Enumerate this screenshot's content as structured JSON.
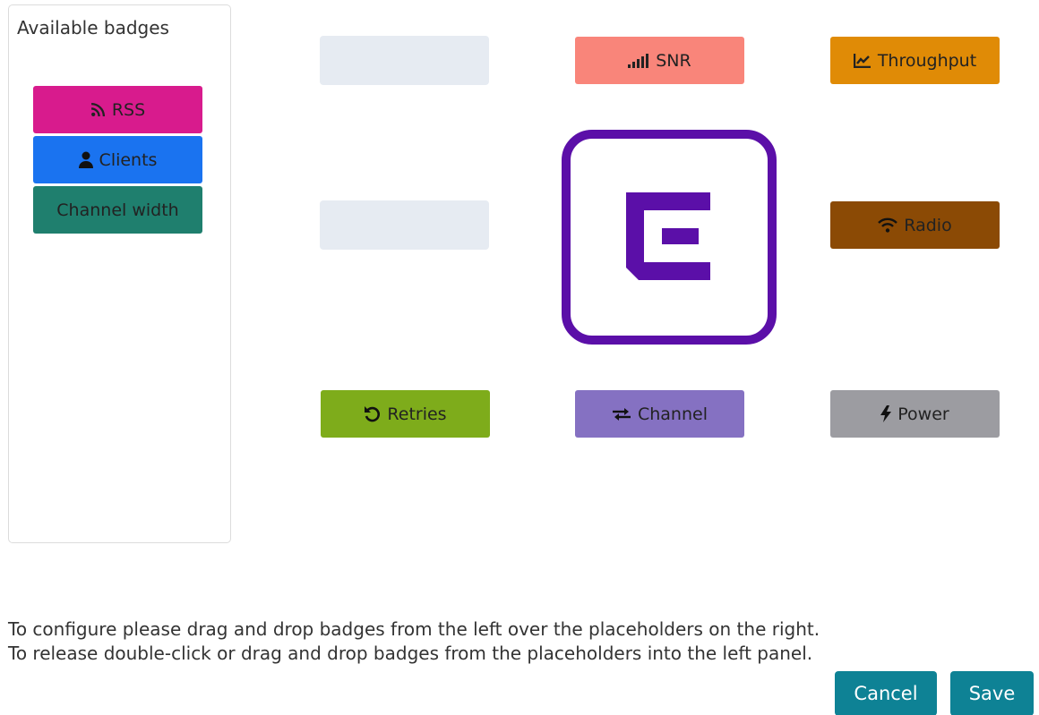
{
  "panel": {
    "title": "Available badges",
    "badges": [
      {
        "label": "RSS",
        "icon": "rss-icon",
        "color": "#d81b8d"
      },
      {
        "label": "Clients",
        "icon": "user-icon",
        "color": "#1a73f0"
      },
      {
        "label": "Channel width",
        "icon": "",
        "color": "#1f7f6e"
      }
    ]
  },
  "slots": {
    "top_left": {
      "label": "",
      "empty": true
    },
    "top_center": {
      "label": "SNR",
      "icon": "signal-bars-icon",
      "color": "#f9857a"
    },
    "top_right": {
      "label": "Throughput",
      "icon": "area-chart-icon",
      "color": "#e08b06"
    },
    "mid_left": {
      "label": "",
      "empty": true
    },
    "mid_right": {
      "label": "Radio",
      "icon": "wifi-icon",
      "color": "#8b4a05"
    },
    "bottom_left": {
      "label": "Retries",
      "icon": "undo-icon",
      "color": "#7eac1b"
    },
    "bottom_center": {
      "label": "Channel",
      "icon": "exchange-icon",
      "color": "#8571c2"
    },
    "bottom_right": {
      "label": "Power",
      "icon": "bolt-icon",
      "color": "#9c9ca1"
    }
  },
  "device": {
    "icon": "extreme-logo-icon",
    "color": "#5b0fa8"
  },
  "instructions": {
    "line1": "To configure please drag and drop badges from the left over the placeholders on the right.",
    "line2": "To release double-click or drag and drop badges from the placeholders into the left panel."
  },
  "actions": {
    "cancel_label": "Cancel",
    "save_label": "Save",
    "button_color": "#0e8295"
  }
}
